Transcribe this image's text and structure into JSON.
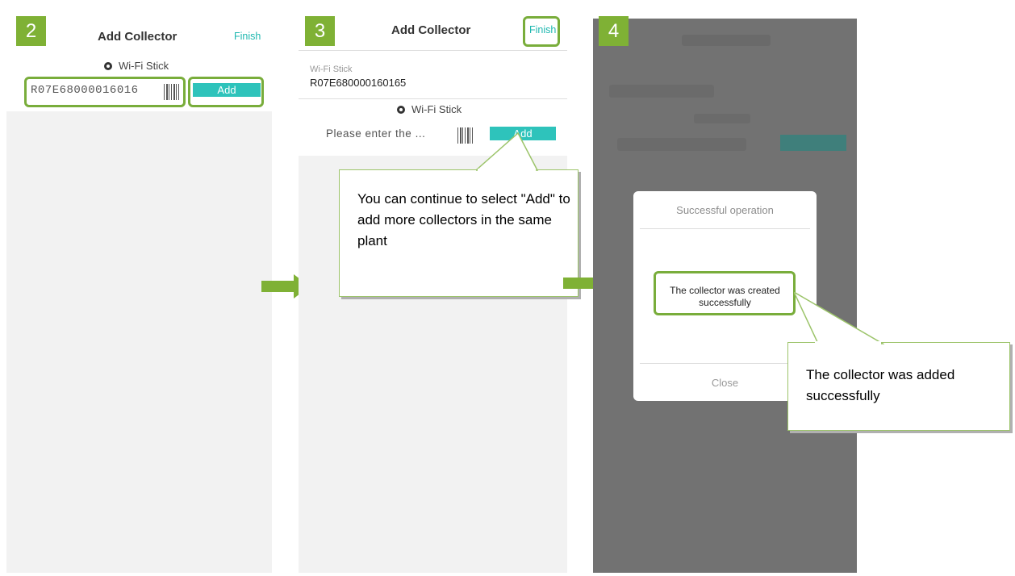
{
  "steps": {
    "s2": "2",
    "s3": "3",
    "s4": "4"
  },
  "screen2": {
    "title": "Add Collector",
    "finish": "Finish",
    "radio_label": "Wi-Fi Stick",
    "serial_value": "R07E68000016016",
    "add_label": "Add"
  },
  "screen3": {
    "title": "Add Collector",
    "finish": "Finish",
    "added_label": "Wi-Fi Stick",
    "added_serial": "R07E680000160165",
    "radio_label": "Wi-Fi Stick",
    "placeholder": "Please enter the ...",
    "add_label": "Add",
    "callout": "You can continue to select \"Add\" to add more collectors in the same plant"
  },
  "screen4": {
    "dialog_title": "Successful operation",
    "dialog_message": "The collector was created successfully",
    "close_label": "Close",
    "callout": "The collector was added successfully"
  },
  "colors": {
    "accent_green": "#79ad3b",
    "teal": "#2ec3bb",
    "badge_green": "#7fb135"
  },
  "icons": [
    "radio-icon",
    "barcode-icon",
    "arrow-right-icon"
  ]
}
